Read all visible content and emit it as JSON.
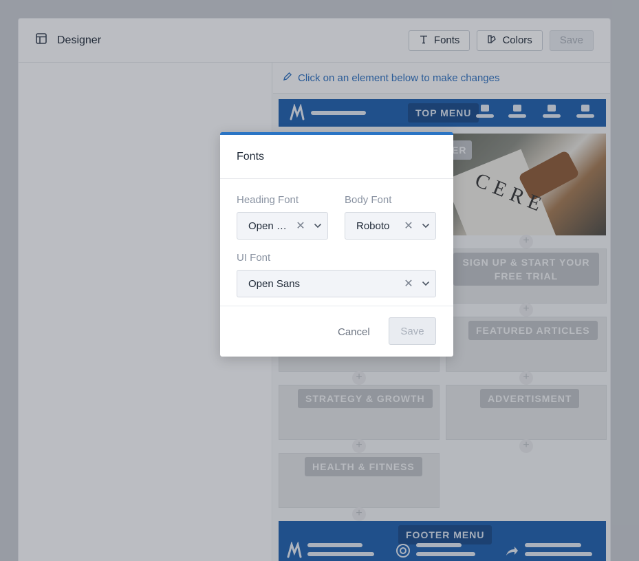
{
  "header": {
    "title": "Designer",
    "fonts_label": "Fonts",
    "colors_label": "Colors",
    "save_label": "Save"
  },
  "preview": {
    "hint": "Click on an element below to make changes",
    "top_menu": "TOP MENU",
    "hero_badge_partial": "ER",
    "signup": "SIGN UP & START YOUR FREE TRIAL",
    "featured": "FEATURED ARTICLES",
    "strategy": "STRATEGY & GROWTH",
    "advertisment": "ADVERTISMENT",
    "health": "HEALTH & FITNESS",
    "footer_menu": "FOOTER MENU",
    "hero_text": "CERE"
  },
  "modal": {
    "title": "Fonts",
    "heading_font_label": "Heading Font",
    "heading_font_value": "Open Sans",
    "body_font_label": "Body Font",
    "body_font_value": "Roboto",
    "ui_font_label": "UI Font",
    "ui_font_value": "Open Sans",
    "cancel_label": "Cancel",
    "save_label": "Save"
  },
  "colors": {
    "brand_blue": "#1d5fae",
    "accent_blue": "#2a74c4"
  }
}
